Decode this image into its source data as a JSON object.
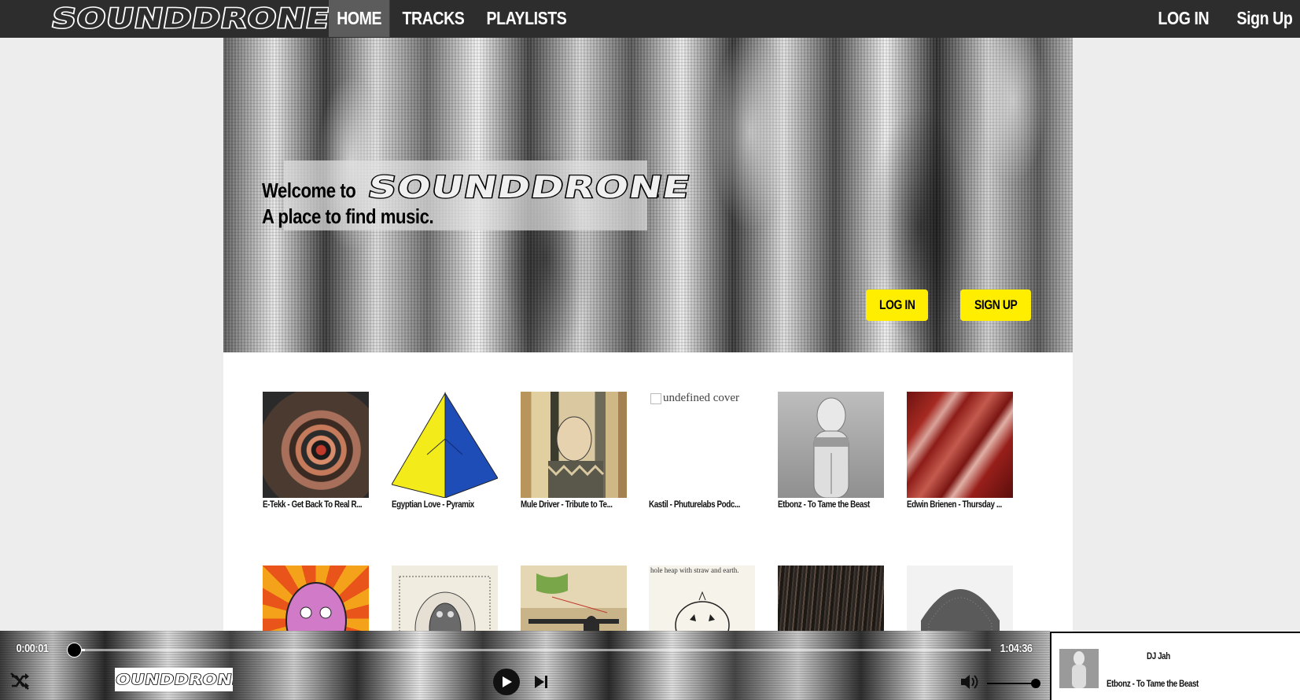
{
  "nav": {
    "logo": "SOUNDDRONE",
    "links": [
      "HOME",
      "TRACKS",
      "PLAYLISTS"
    ],
    "login": "LOG IN",
    "signup": "Sign Up"
  },
  "hero": {
    "welcome": "Welcome to",
    "logo": "SOUNDDRONE",
    "period": ".",
    "tagline": "A place to find music.",
    "login_button": "LOG IN",
    "signup_button": "SIGN UP"
  },
  "tracks": [
    {
      "title": "E-Tekk - Get Back To Real R...",
      "cover_icon": "spiral-portrait-cover"
    },
    {
      "title": "Egyptian Love - Pyramix",
      "cover_icon": "pyramid-cube-cover"
    },
    {
      "title": "Mule Driver - Tribute to Te...",
      "cover_icon": "ukiyo-e-cover"
    },
    {
      "title": "Kastil - Phuturelabs Podc...",
      "cover_alt": "undefined cover",
      "cover_icon": "broken-image-icon"
    },
    {
      "title": "Etbonz - To Tame the Beast",
      "cover_icon": "egyptian-jar-cover"
    },
    {
      "title": "Edwin Brienen - Thursday ...",
      "cover_icon": "raw-meat-cover"
    },
    {
      "title": "",
      "cover_icon": "psychedelic-face-cover"
    },
    {
      "title": "",
      "cover_icon": "owl-sketch-cover"
    },
    {
      "title": "",
      "cover_icon": "japanese-print-cover"
    },
    {
      "title": "",
      "cover_caption": "hole heap with straw and earth.",
      "cover_icon": "pumpkin-sketch-cover"
    },
    {
      "title": "",
      "cover_icon": "dark-hair-cover"
    },
    {
      "title": "",
      "cover_icon": "dome-texture-cover"
    }
  ],
  "player": {
    "current_time": "0:00:01",
    "total_time": "1:04:36",
    "progress": 0.0003,
    "logo": "SOUNDDRONE",
    "volume": 1.0
  },
  "now_playing": {
    "artist": "DJ Jah",
    "title": "Etbonz - To Tame the Beast"
  },
  "colors": {
    "nav_bg": "#2d2d2d",
    "nav_active": "#5c5c5c",
    "accent_yellow": "#ffee00"
  }
}
